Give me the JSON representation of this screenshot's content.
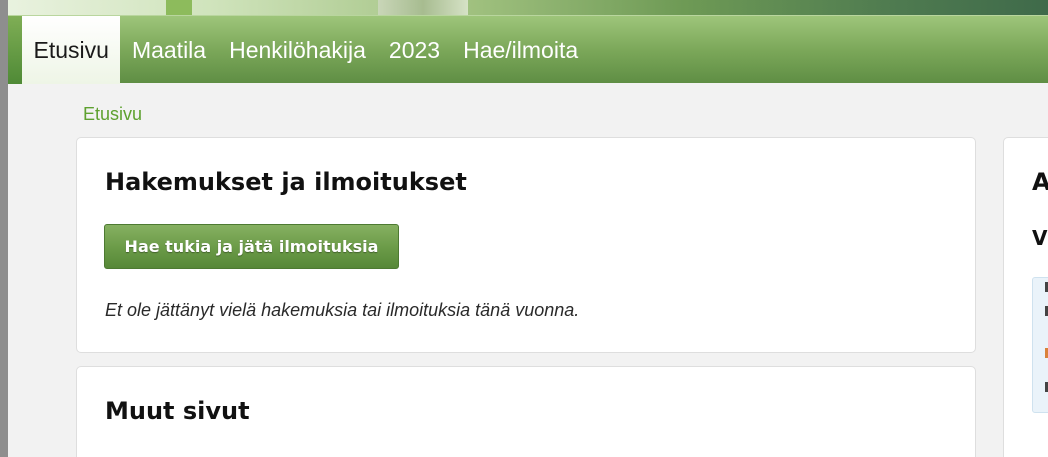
{
  "nav": {
    "items": [
      {
        "label": "Etusivu",
        "active": true
      },
      {
        "label": "Maatila",
        "active": false
      },
      {
        "label": "Henkilöhakija",
        "active": false
      },
      {
        "label": "2023",
        "active": false
      },
      {
        "label": "Hae/ilmoita",
        "active": false
      }
    ]
  },
  "breadcrumb": {
    "label": "Etusivu"
  },
  "applications": {
    "title": "Hakemukset ja ilmoitukset",
    "button_label": "Hae tukia ja jätä ilmoituksia",
    "empty_message": "Et ole jättänyt vielä hakemuksia tai ilmoituksia tänä vuonna."
  },
  "other_pages": {
    "title": "Muut sivut"
  },
  "side_panel": {
    "title_fragment": "A",
    "subtitle_fragment": "Vi"
  },
  "colors": {
    "accent_green": "#6a9a47",
    "breadcrumb_green": "#5ea12f",
    "nav_active_bg": "#ffffff"
  }
}
